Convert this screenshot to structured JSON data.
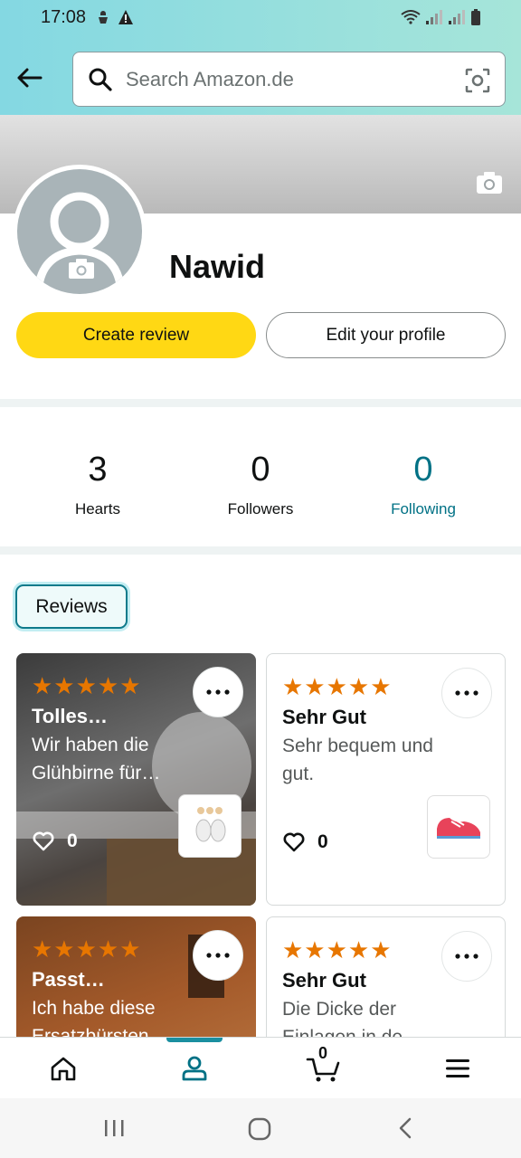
{
  "status_bar": {
    "time": "17:08"
  },
  "search": {
    "placeholder": "Search Amazon.de"
  },
  "profile": {
    "name": "Nawid"
  },
  "actions": {
    "create_review": "Create review",
    "edit_profile": "Edit your profile"
  },
  "stats": [
    {
      "value": "3",
      "label": "Hearts"
    },
    {
      "value": "0",
      "label": "Followers"
    },
    {
      "value": "0",
      "label": "Following"
    }
  ],
  "tabs": {
    "reviews": "Reviews"
  },
  "reviews": [
    {
      "stars": "★★★★★",
      "title": "Tolles…",
      "body": "Wir haben die Glühbirne für…",
      "likes": "0"
    },
    {
      "stars": "★★★★★",
      "title": "Sehr Gut",
      "body": "Sehr bequem und gut.",
      "likes": "0"
    },
    {
      "stars": "★★★★★",
      "title": "Passt…",
      "body": "Ich habe diese Ersatzbürsten",
      "likes": ""
    },
    {
      "stars": "★★★★★",
      "title": "Sehr Gut",
      "body": "Die Dicke der Einlagen in de",
      "likes": ""
    }
  ],
  "bottom_nav": {
    "cart_count": "0"
  },
  "colors": {
    "accent": "#007185",
    "button_primary": "#ffd814",
    "star": "#e77600",
    "header_gradient_start": "#84d8e2"
  }
}
